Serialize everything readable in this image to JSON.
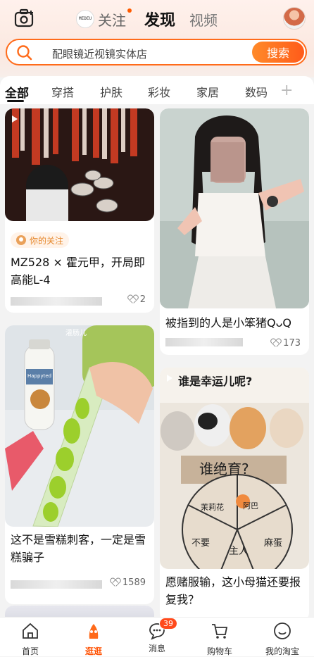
{
  "header": {
    "tabs": [
      {
        "label": "关注",
        "has_dot": true
      },
      {
        "label": "发现",
        "active": true
      },
      {
        "label": "视频"
      }
    ],
    "brand_logo_text": "夏·梦迪 MEDEU"
  },
  "search": {
    "placeholder": "配眼镜近视镜实体店",
    "button_label": "搜索"
  },
  "categories": [
    "全部",
    "穿搭",
    "护肤",
    "彩妆",
    "家居",
    "数码"
  ],
  "active_category": "全部",
  "feed": {
    "left": [
      {
        "title": "MZ528 × 霍元甲，开局即高能L-4",
        "tag": "你的关注",
        "likes": "2"
      },
      {
        "title": "这不是雪糕刺客，一定是雪糕骗子",
        "likes": "1589",
        "image_text": "Happyted",
        "image_text2": "灌肠儿"
      }
    ],
    "right": [
      {
        "title": "被指到的人是小笨猪QᴗQ",
        "likes": "173"
      },
      {
        "title": "愿赌服输，这小母猫还要报复我？",
        "image_text": "谁是幸运儿呢?",
        "wheel_center": "谁绝育?",
        "wheel_labels": [
          "茉莉花",
          "阿巴",
          "不要",
          "主人",
          "麻蛋"
        ]
      }
    ]
  },
  "bottom_nav": [
    {
      "label": "首页"
    },
    {
      "label": "逛逛",
      "active": true
    },
    {
      "label": "消息",
      "badge": "39"
    },
    {
      "label": "购物车"
    },
    {
      "label": "我的淘宝"
    }
  ],
  "colors": {
    "accent": "#ff5a00",
    "accent_light": "#fff3e9"
  }
}
